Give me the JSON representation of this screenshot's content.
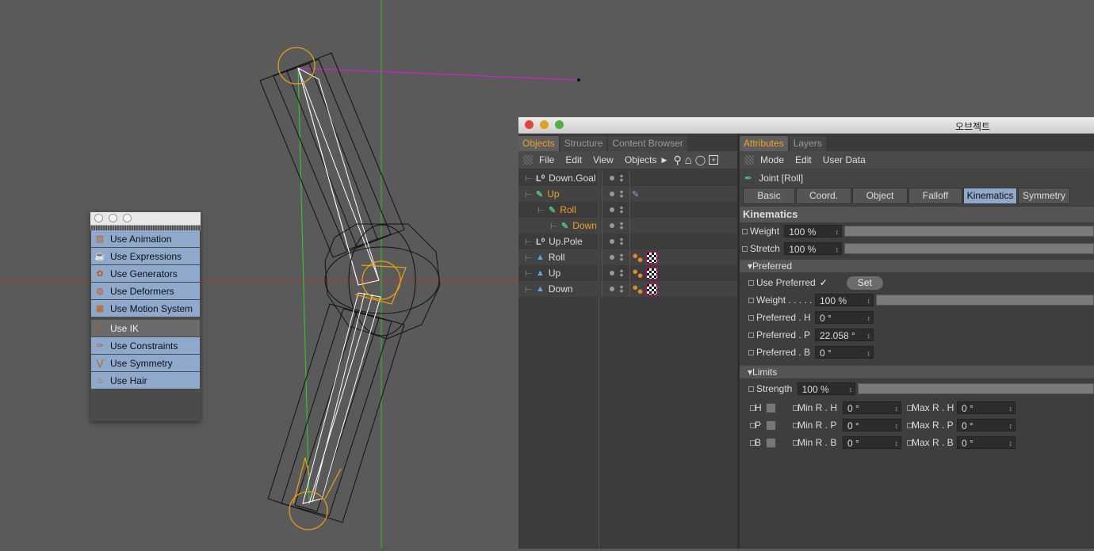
{
  "viewport": {
    "axis_colors": {
      "x": "#c83030",
      "y": "#30c030",
      "ik_line": "#d020d0",
      "null": "#f0a010"
    }
  },
  "palette": {
    "items": [
      {
        "label": "Use Animation",
        "icon": "film-strip-icon",
        "selected": false
      },
      {
        "label": "Use Expressions",
        "icon": "expression-cup-icon",
        "selected": false
      },
      {
        "label": "Use Generators",
        "icon": "generator-icon",
        "selected": false
      },
      {
        "label": "Use Deformers",
        "icon": "deformer-icon",
        "selected": false
      },
      {
        "label": "Use Motion System",
        "icon": "motion-system-icon",
        "selected": false
      },
      {
        "label": "Use IK",
        "icon": "ik-icon",
        "selected": true
      },
      {
        "label": "Use Constraints",
        "icon": "constraint-icon",
        "selected": false
      },
      {
        "label": "Use Symmetry",
        "icon": "symmetry-icon",
        "selected": false
      },
      {
        "label": "Use Hair",
        "icon": "hair-icon",
        "selected": false
      }
    ]
  },
  "window": {
    "title": "오브젝트",
    "colors": {
      "accent": "#f0a020",
      "selected_tab": "#8fa9cc"
    },
    "object_manager": {
      "tabs": [
        "Objects",
        "Structure",
        "Content Browser"
      ],
      "active_tab": "Objects",
      "menu": [
        "File",
        "Edit",
        "View",
        "Objects"
      ],
      "rows": [
        {
          "name": "Down.Goal",
          "icon": "null-object-icon",
          "highlight": false,
          "tags": []
        },
        {
          "name": "Up",
          "icon": "joint-icon",
          "highlight": true,
          "tags": [
            "joint-tag-icon"
          ]
        },
        {
          "name": "Roll",
          "icon": "joint-icon",
          "highlight": true,
          "tags": []
        },
        {
          "name": "Down",
          "icon": "joint-icon",
          "highlight": true,
          "tags": []
        },
        {
          "name": "Up.Pole",
          "icon": "null-object-icon",
          "highlight": false,
          "tags": []
        },
        {
          "name": "Roll",
          "icon": "bone-icon",
          "highlight": false,
          "tags": [
            "ik-tag-icon",
            "checker-tag-icon"
          ]
        },
        {
          "name": "Up",
          "icon": "bone-icon",
          "highlight": false,
          "tags": [
            "ik-tag-icon",
            "checker-tag-icon"
          ]
        },
        {
          "name": "Down",
          "icon": "bone-icon",
          "highlight": false,
          "tags": [
            "ik-tag-icon",
            "checker-tag-icon"
          ]
        }
      ]
    },
    "attribute_manager": {
      "tabs": [
        "Attributes",
        "Layers"
      ],
      "active_tab": "Attributes",
      "menu": [
        "Mode",
        "Edit",
        "User Data"
      ],
      "object_title": "Joint [Roll]",
      "sub_tabs": [
        "Basic",
        "Coord.",
        "Object",
        "Falloff",
        "Kinematics",
        "Symmetry"
      ],
      "active_sub_tab": "Kinematics",
      "section": "Kinematics",
      "weight": {
        "label": "Weight",
        "value": "100 %"
      },
      "stretch": {
        "label": "Stretch",
        "value": "100 %"
      },
      "preferred": {
        "header": "Preferred",
        "use_preferred": "Use Preferred",
        "checkmark": "✓",
        "set_button": "Set",
        "weight": {
          "label": "Weight . . . . .",
          "value": "100 %"
        },
        "h": {
          "label": "Preferred . H",
          "value": "0 °"
        },
        "p": {
          "label": "Preferred . P",
          "value": "22.058 °"
        },
        "b": {
          "label": "Preferred . B",
          "value": "0 °"
        }
      },
      "limits": {
        "header": "Limits",
        "strength": {
          "label": "Strength",
          "value": "100 %"
        },
        "axes": [
          "H",
          "P",
          "B"
        ],
        "min": [
          {
            "label": "Min R . H",
            "value": "0 °"
          },
          {
            "label": "Min R . P",
            "value": "0 °"
          },
          {
            "label": "Min R . B",
            "value": "0 °"
          }
        ],
        "max": [
          {
            "label": "Max R . H",
            "value": "0 °"
          },
          {
            "label": "Max R . P",
            "value": "0 °"
          },
          {
            "label": "Max R . B",
            "value": "0 °"
          }
        ]
      }
    }
  }
}
